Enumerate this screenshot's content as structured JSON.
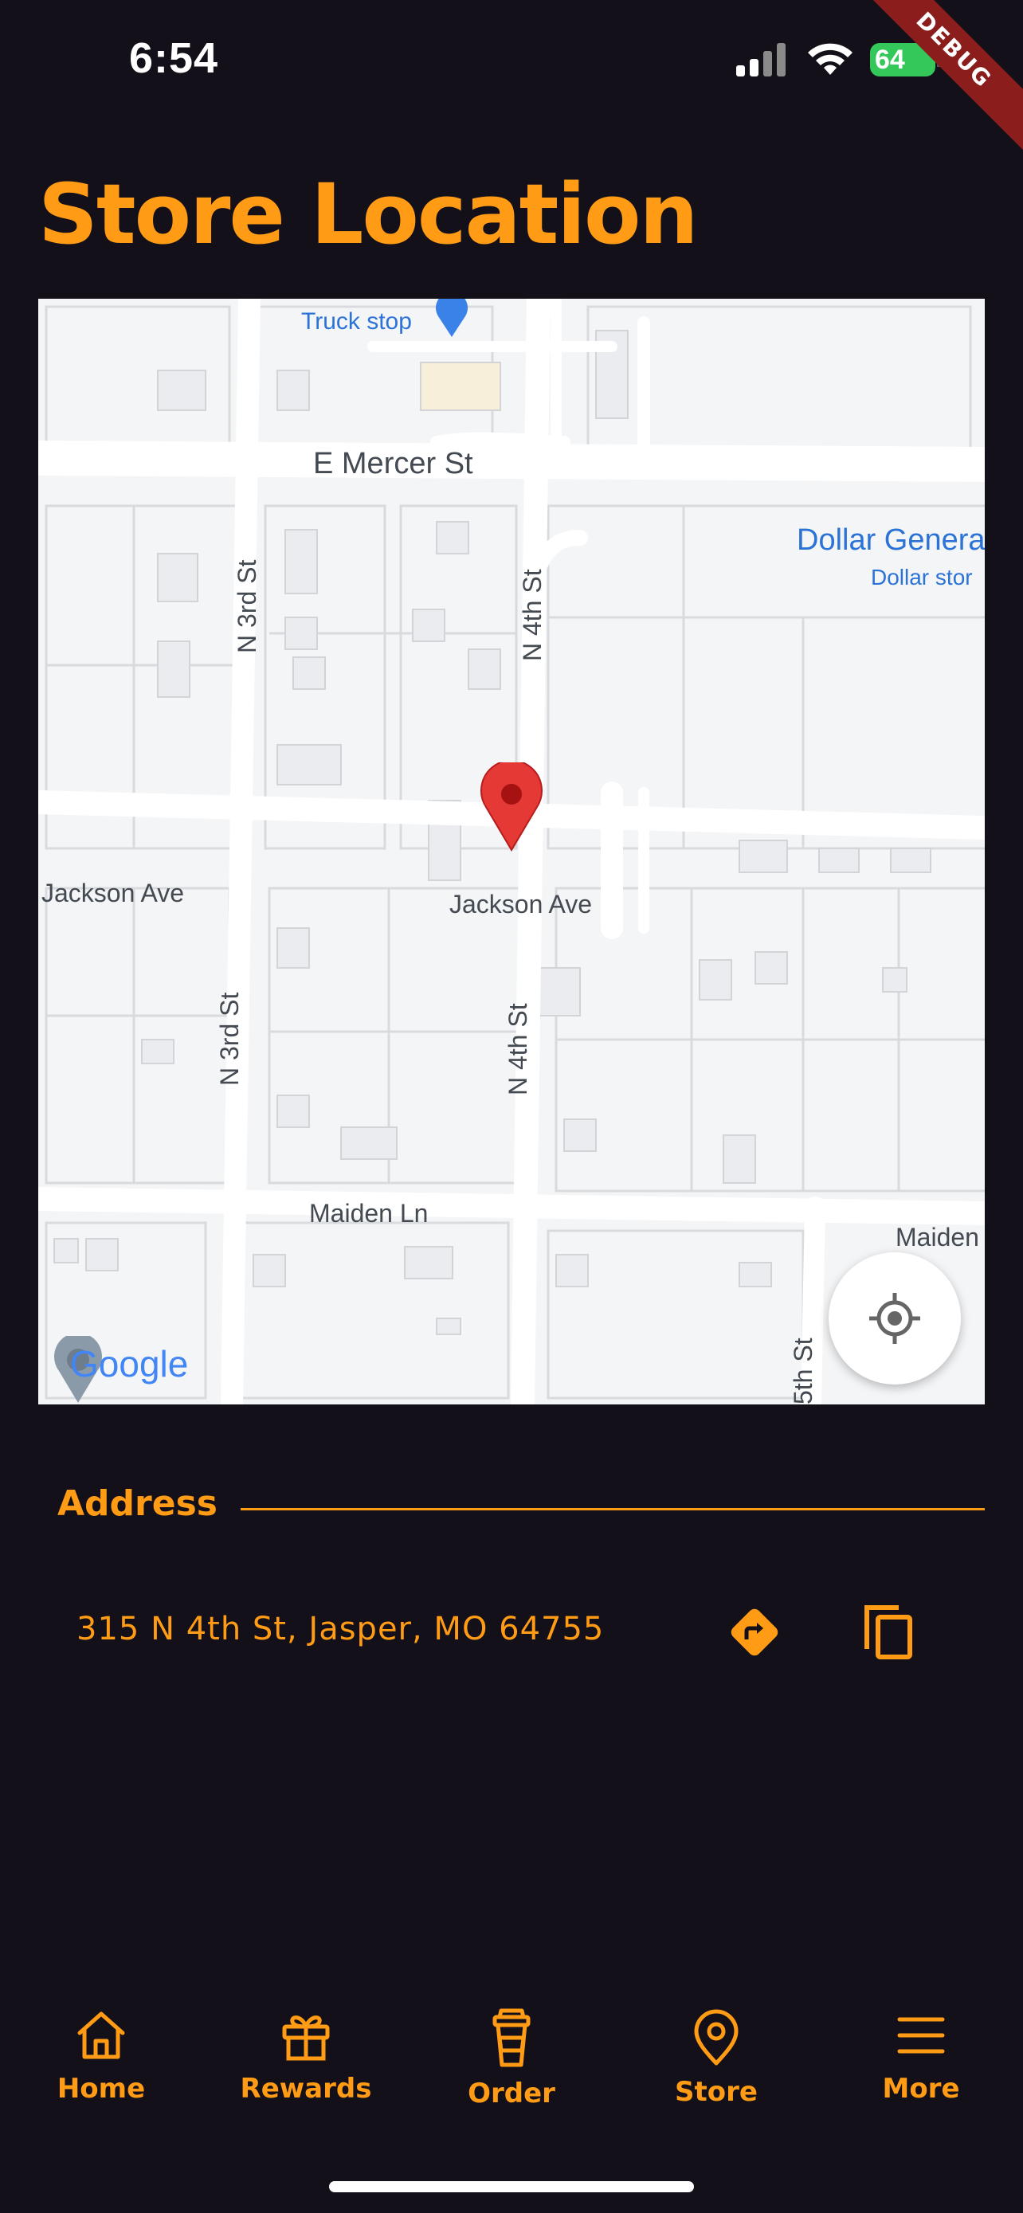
{
  "status_bar": {
    "time": "6:54",
    "battery": "64",
    "debug_label": "DEBUG"
  },
  "page": {
    "title": "Store Location"
  },
  "map": {
    "labels": {
      "truck_stop": "Truck stop",
      "e_mercer": "E Mercer St",
      "dollar_general": "Dollar Genera",
      "dollar_store": "Dollar stor",
      "n_3rd_top": "N 3rd St",
      "n_4th_top": "N 4th St",
      "jackson_left": "Jackson Ave",
      "jackson_center": "Jackson Ave",
      "n_3rd_bottom": "N 3rd St",
      "n_4th_bottom": "N 4th St",
      "maiden_ln": "Maiden Ln",
      "maiden_right": "Maiden",
      "fifth_st": "5th St"
    },
    "attribution": "Google",
    "marker_color": "#e53935"
  },
  "address": {
    "heading": "Address",
    "value": "315 N 4th St, Jasper, MO 64755"
  },
  "nav": {
    "items": [
      {
        "label": "Home",
        "icon": "home-icon"
      },
      {
        "label": "Rewards",
        "icon": "gift-icon"
      },
      {
        "label": "Order",
        "icon": "cup-icon"
      },
      {
        "label": "Store",
        "icon": "location-pin-icon"
      },
      {
        "label": "More",
        "icon": "menu-icon"
      }
    ]
  },
  "colors": {
    "accent": "#ff9b14",
    "background": "#131019"
  }
}
